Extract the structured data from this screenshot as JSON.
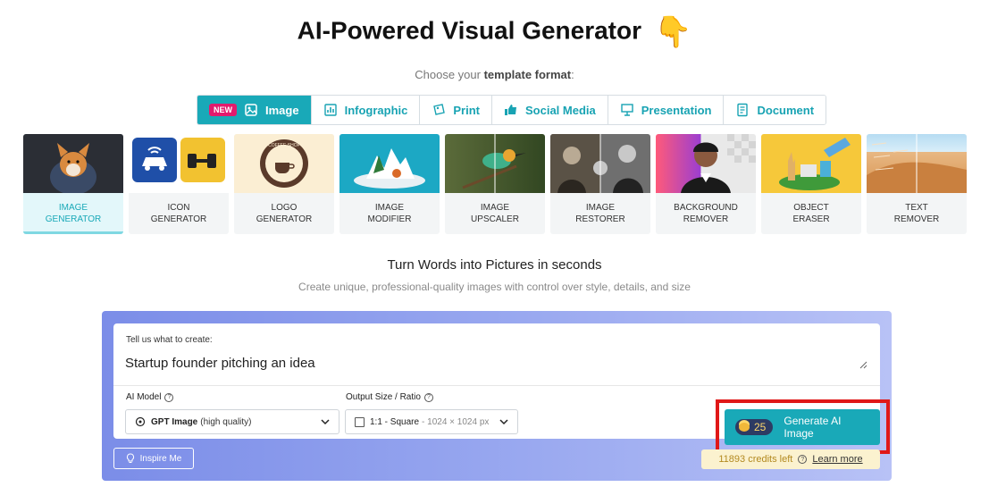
{
  "header": {
    "title": "AI-Powered Visual Generator",
    "hand_icon": "pointing-down-hand-icon",
    "subtitle_prefix": "Choose your",
    "subtitle_bold": "template format",
    "subtitle_suffix": ":"
  },
  "formats": [
    {
      "badge": "NEW",
      "label": "Image",
      "icon": "image-icon",
      "active": true
    },
    {
      "label": "Infographic",
      "icon": "chart-icon"
    },
    {
      "label": "Print",
      "icon": "print-icon"
    },
    {
      "label": "Social Media",
      "icon": "thumbs-up-icon"
    },
    {
      "label": "Presentation",
      "icon": "presentation-icon"
    },
    {
      "label": "Document",
      "icon": "document-icon"
    }
  ],
  "tools": [
    {
      "line1": "IMAGE",
      "line2": "GENERATOR",
      "active": true
    },
    {
      "line1": "ICON",
      "line2": "GENERATOR"
    },
    {
      "line1": "LOGO",
      "line2": "GENERATOR"
    },
    {
      "line1": "IMAGE",
      "line2": "MODIFIER"
    },
    {
      "line1": "IMAGE",
      "line2": "UPSCALER"
    },
    {
      "line1": "IMAGE",
      "line2": "RESTORER"
    },
    {
      "line1": "BACKGROUND",
      "line2": "REMOVER"
    },
    {
      "line1": "OBJECT",
      "line2": "ERASER"
    },
    {
      "line1": "TEXT",
      "line2": "REMOVER"
    }
  ],
  "logo_thumb_text": "COFFEE SHOP",
  "hero": {
    "title": "Turn Words into Pictures in seconds",
    "subtitle": "Create unique, professional-quality images with control over style, details, and size"
  },
  "form": {
    "prompt_label": "Tell us what to create:",
    "prompt_value": "Startup founder pitching an idea",
    "model_label": "AI Model",
    "model_value": "GPT Image",
    "model_note": "(high quality)",
    "size_label": "Output Size / Ratio",
    "size_value": "1:1 - Square",
    "size_note": "- 1024 × 1024 px",
    "generate_cost": "25",
    "generate_label": "Generate AI Image",
    "inspire_label": "Inspire Me",
    "credits_text": "11893 credits left",
    "learn_more": "Learn more"
  },
  "colors": {
    "accent": "#19a9b8",
    "new_badge": "#e31a6d",
    "highlight_outline": "#e01818",
    "credits_bg": "#fbf2cf"
  }
}
